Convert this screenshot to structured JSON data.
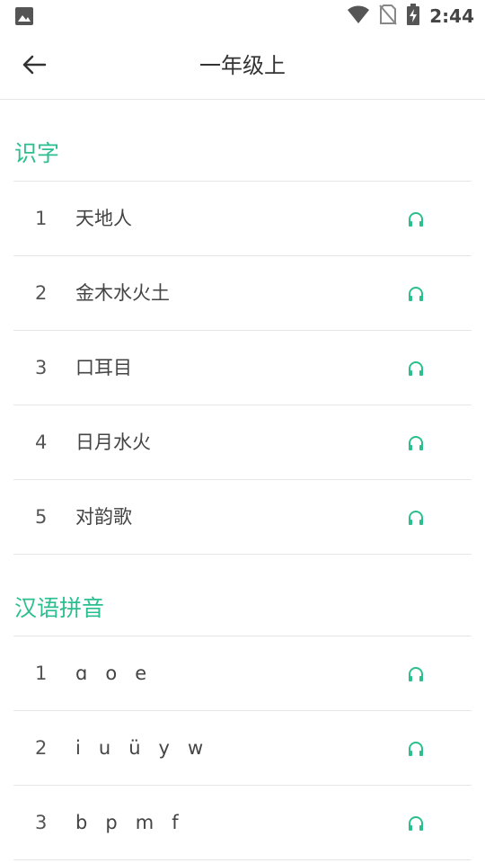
{
  "status_bar": {
    "time": "2:44",
    "icons": [
      "gallery-icon",
      "wifi-icon",
      "no-sim-icon",
      "battery-charging-icon"
    ]
  },
  "toolbar": {
    "title": "一年级上",
    "back_icon": "arrow-left-icon"
  },
  "accent_color": "#2bbf8f",
  "sections": [
    {
      "title": "识字",
      "items": [
        {
          "num": "1",
          "text": "天地人"
        },
        {
          "num": "2",
          "text": "金木水火土"
        },
        {
          "num": "3",
          "text": "口耳目"
        },
        {
          "num": "4",
          "text": "日月水火"
        },
        {
          "num": "5",
          "text": "对韵歌"
        }
      ]
    },
    {
      "title": "汉语拼音",
      "items": [
        {
          "num": "1",
          "text": "ɑ   o   e"
        },
        {
          "num": "2",
          "text": "i   u   ü   y   w"
        },
        {
          "num": "3",
          "text": "b   p   m   f"
        }
      ]
    }
  ]
}
